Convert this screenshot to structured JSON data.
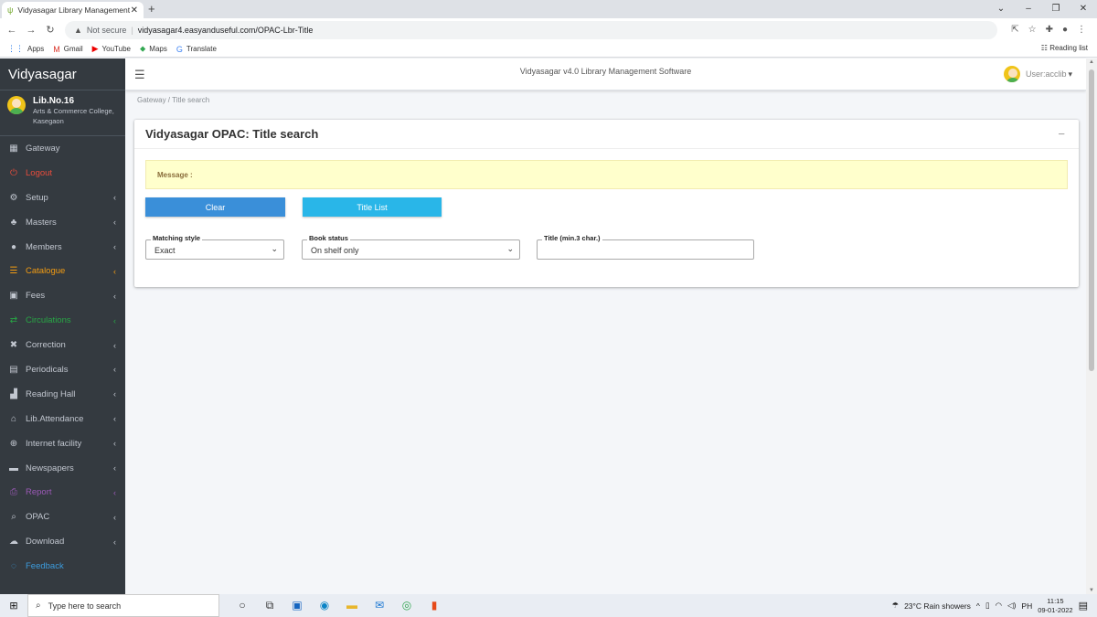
{
  "browser": {
    "tab_title": "Vidyasagar Library Management",
    "address_warning": "Not secure",
    "url": "vidyasagar4.easyanduseful.com/OPAC-Lbr-Title",
    "bookmarks": [
      {
        "icon": "⋮⋮",
        "label": "Apps"
      },
      {
        "icon": "M",
        "label": "Gmail"
      },
      {
        "icon": "▶",
        "label": "YouTube"
      },
      {
        "icon": "⬥",
        "label": "Maps"
      },
      {
        "icon": "G",
        "label": "Translate"
      }
    ],
    "reading_list": "Reading list"
  },
  "sidebar": {
    "brand": "Vidyasagar",
    "user": {
      "lib_no": "Lib.No.16",
      "college_line1": "Arts & Commerce College,",
      "college_line2": "Kasegaon"
    },
    "items": [
      {
        "label": "Gateway",
        "icon": "▦"
      },
      {
        "label": "Logout",
        "icon": "⏻"
      },
      {
        "label": "Setup",
        "icon": "⚙"
      },
      {
        "label": "Masters",
        "icon": "♣"
      },
      {
        "label": "Members",
        "icon": "●"
      },
      {
        "label": "Catalogue",
        "icon": "☰"
      },
      {
        "label": "Fees",
        "icon": "▣"
      },
      {
        "label": "Circulations",
        "icon": "⇄"
      },
      {
        "label": "Correction",
        "icon": "✖"
      },
      {
        "label": "Periodicals",
        "icon": "▤"
      },
      {
        "label": "Reading Hall",
        "icon": "▟"
      },
      {
        "label": "Lib.Attendance",
        "icon": "⌂"
      },
      {
        "label": "Internet facility",
        "icon": "⊕"
      },
      {
        "label": "Newspapers",
        "icon": "▬"
      },
      {
        "label": "Report",
        "icon": "⎙"
      },
      {
        "label": "OPAC",
        "icon": "⌕"
      },
      {
        "label": "Download",
        "icon": "☁"
      },
      {
        "label": "Feedback",
        "icon": "◌"
      }
    ],
    "chevron": "‹"
  },
  "topnav": {
    "app_title": "Vidyasagar v4.0 Library Management Software",
    "user_label": "User:acclib"
  },
  "breadcrumb": "Gateway / Title search",
  "card": {
    "title": "Vidyasagar OPAC: Title search",
    "message_label": "Message :",
    "clear_label": "Clear",
    "title_list_label": "Title List",
    "matching_style": {
      "label": "Matching style",
      "value": "Exact"
    },
    "book_status": {
      "label": "Book status",
      "value": "On shelf only"
    },
    "title_field": {
      "label": "Title (min.3 char.)",
      "value": ""
    }
  },
  "taskbar": {
    "search_placeholder": "Type here to search",
    "weather": "23°C  Rain showers",
    "lang": "PH",
    "time": "11:15",
    "date": "09-01-2022"
  }
}
